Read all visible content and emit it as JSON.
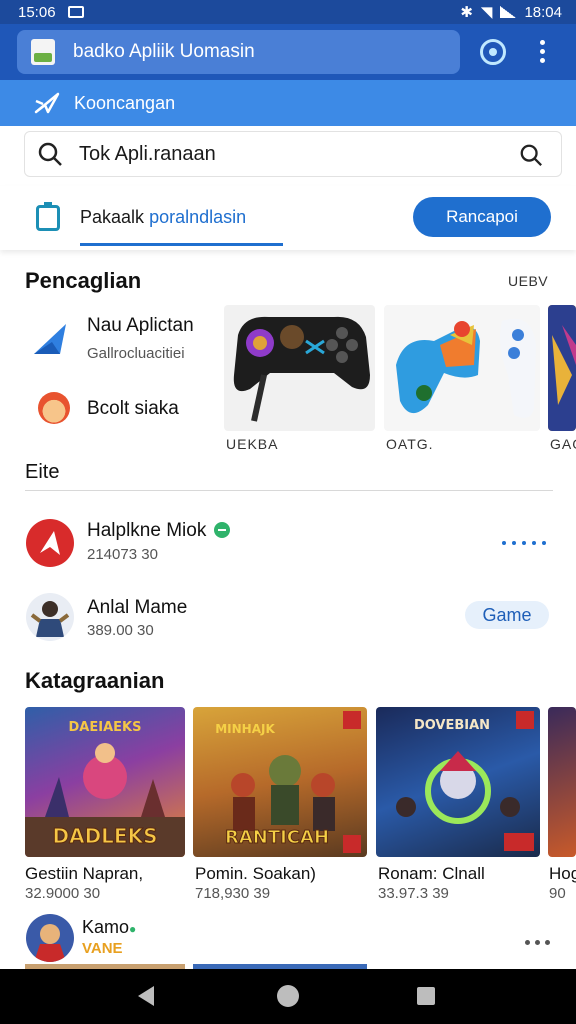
{
  "status_bar": {
    "time": "15:06",
    "right_time": "18:04"
  },
  "app_bar": {
    "url_text": "badko Apliik Uomasin"
  },
  "sub_bar": {
    "label": "Kooncangan"
  },
  "search": {
    "value": "Tok Apli.ranaan"
  },
  "tab_row": {
    "tab_label_plain": "Pakaalk",
    "tab_label_highlight": "poralndlasin",
    "button_label": "Rancapoi"
  },
  "pencaglian": {
    "title": "Pencaglian",
    "see_all": "UEBV",
    "items": [
      {
        "title": "Nau Aplictan",
        "subtitle": "Gallrocluacitiei"
      },
      {
        "title": "Bcolt siaka"
      }
    ],
    "cards": [
      {
        "label": "UEKBA"
      },
      {
        "label": "OATG."
      },
      {
        "label": "GAG"
      }
    ]
  },
  "eite": {
    "title": "Eite",
    "items": [
      {
        "title": "Halplkne Miok",
        "subtitle": "214073 30"
      },
      {
        "title": "Anlal Mame",
        "subtitle": "389.00 30",
        "badge": "Game"
      }
    ]
  },
  "kategraanian": {
    "title": "Katagraanian",
    "items": [
      {
        "title": "Gestiin Napran,",
        "subtitle": "32.9000 30",
        "art_top": "DAEIAEKS",
        "art_bottom": "DADLEKS"
      },
      {
        "title": "Pomin. Soakan)",
        "subtitle": "718,930 39",
        "art_top": "MINHAJK",
        "art_bottom": "RANTICAH"
      },
      {
        "title": "Ronam: Clnall",
        "subtitle": "33.97.3 39",
        "art_top": "DOVEBIAN"
      },
      {
        "title": "Hog",
        "subtitle": "90"
      }
    ]
  },
  "bottom_item": {
    "title": "Kamo",
    "subtitle": "VANE"
  },
  "colors": {
    "primary": "#1f6fcf",
    "appbar": "#1f57b8",
    "subbar": "#3d8ae6"
  }
}
